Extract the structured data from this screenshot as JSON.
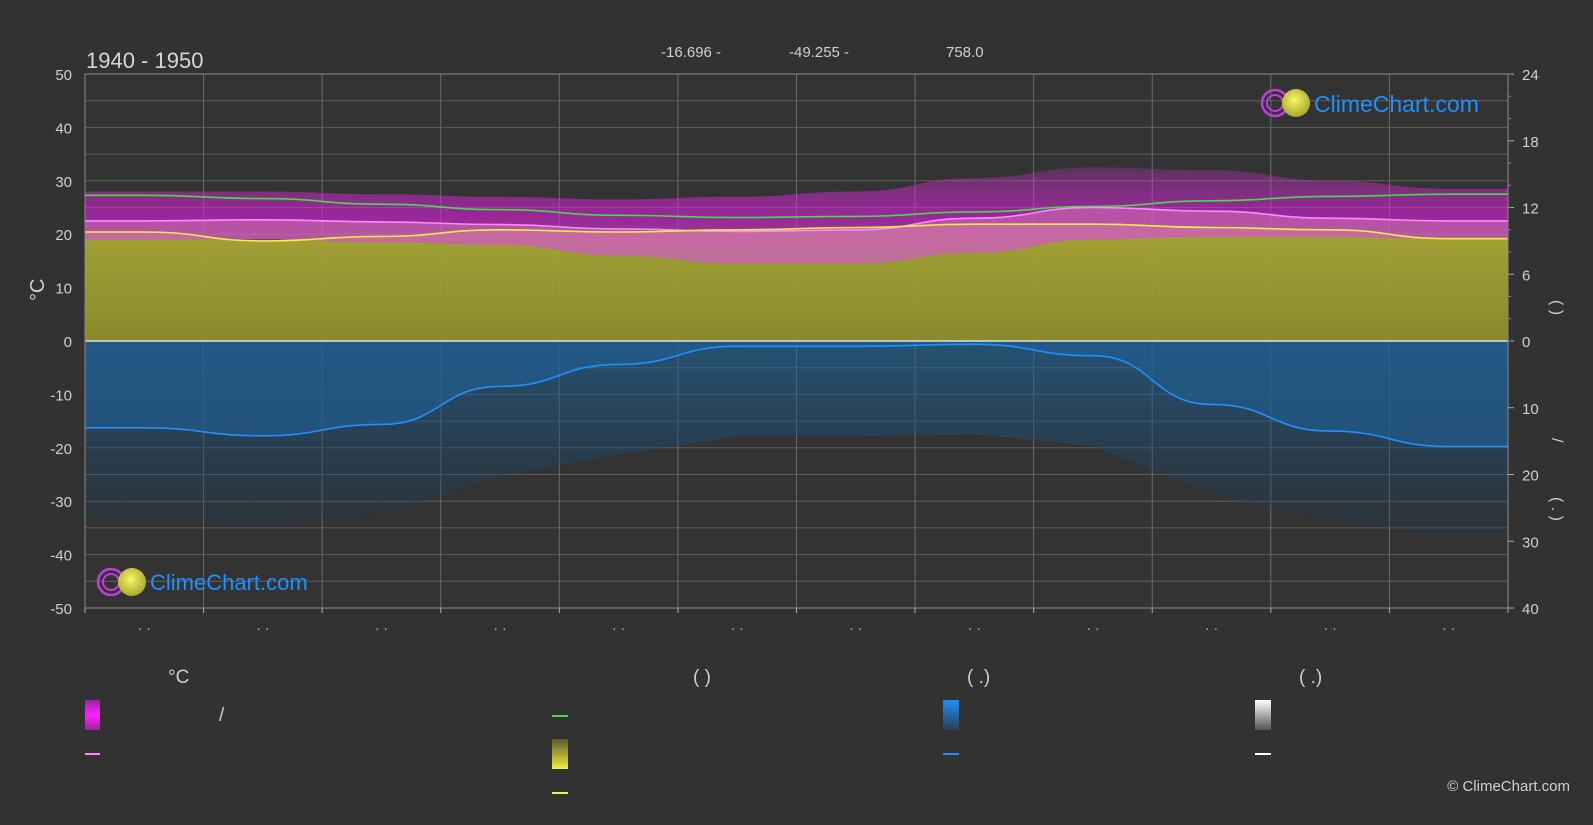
{
  "header": {
    "period": "1940 - 1950",
    "lat": "-16.696 -",
    "lon": "-49.255 -",
    "elevation": "758.0"
  },
  "brand": {
    "watermark": "ClimeChart.com",
    "copyright": "© ClimeChart.com"
  },
  "axes": {
    "left_label": "°C",
    "right_top_fragment": "(    )",
    "right_bottom_fragment": "/",
    "right_bottom_paren": "(  .  )"
  },
  "legend": {
    "col1_header": "°C",
    "col1_item1_sep": "/",
    "col2_header": "(            )",
    "col3_header": "(   .)",
    "col4_header": "(   .)"
  },
  "colors": {
    "background": "#323232",
    "max_band": "#c21fc2",
    "avg_band": "#d46bb8",
    "sunshine": "#b5b52a",
    "precip": "#1f6fae",
    "daylight_line": "#44dd44",
    "avg_temp_line": "#ff88ff",
    "sunshine_line": "#eeee44",
    "precip_line": "#1e90ff",
    "grid": "#5e5e5e"
  },
  "chart_data": {
    "type": "area",
    "x": [
      1,
      2,
      3,
      4,
      5,
      6,
      7,
      8,
      9,
      10,
      11,
      12
    ],
    "xlabel": "",
    "ylabel": "°C",
    "ylim": [
      -50,
      50
    ],
    "y_ticks": [
      50,
      40,
      30,
      20,
      10,
      0,
      -10,
      -20,
      -30,
      -40,
      -50
    ],
    "y2_upper_ticks": [
      24,
      18,
      12,
      6,
      0
    ],
    "y2_lower_ticks": [
      0,
      10,
      20,
      30,
      40
    ],
    "y2_upper_range": [
      0,
      24
    ],
    "y2_lower_range": [
      0,
      40
    ],
    "grid": true,
    "series": [
      {
        "key": "daylight",
        "axis": "y2_upper",
        "values": [
          13.1,
          12.8,
          12.3,
          11.8,
          11.3,
          11.1,
          11.2,
          11.6,
          12.1,
          12.6,
          13.0,
          13.2
        ]
      },
      {
        "key": "avg_temp",
        "axis": "y",
        "values": [
          22.5,
          22.7,
          22.3,
          21.8,
          21.0,
          20.5,
          20.8,
          23.0,
          25.0,
          24.3,
          23.0,
          22.5
        ]
      },
      {
        "key": "sunshine",
        "axis": "y2_upper",
        "values": [
          9.8,
          9.0,
          9.4,
          10.0,
          9.8,
          10.0,
          10.2,
          10.5,
          10.5,
          10.2,
          10.0,
          9.2
        ]
      },
      {
        "key": "precip",
        "axis": "y2_lower",
        "values": [
          13.0,
          14.2,
          12.5,
          6.8,
          3.5,
          0.8,
          0.8,
          0.5,
          2.2,
          9.5,
          13.5,
          15.8
        ]
      },
      {
        "key": "max_temp",
        "axis": "y",
        "values": [
          28,
          28,
          27.5,
          27,
          26.5,
          27,
          28,
          30.5,
          32.5,
          32,
          30,
          28.5
        ]
      },
      {
        "key": "min_temp",
        "axis": "y",
        "values": [
          19,
          19,
          18.5,
          18,
          16,
          14.5,
          14.5,
          16.5,
          19,
          19.5,
          19.5,
          19
        ]
      }
    ]
  }
}
